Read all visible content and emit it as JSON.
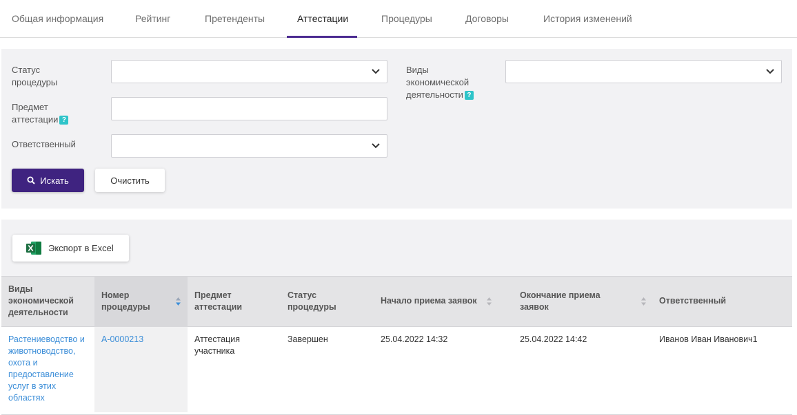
{
  "tabs": [
    {
      "label": "Общая информация"
    },
    {
      "label": "Рейтинг"
    },
    {
      "label": "Претенденты"
    },
    {
      "label": "Аттестации",
      "active": true
    },
    {
      "label": "Процедуры"
    },
    {
      "label": "Договоры"
    },
    {
      "label": "История изменений"
    }
  ],
  "filters": {
    "status_label": "Статус процедуры",
    "status_value": "",
    "subject_label": "Предмет аттестации",
    "subject_value": "",
    "responsible_label": "Ответственный",
    "responsible_value": "",
    "activity_label": "Виды экономической деятельности",
    "activity_value": "",
    "help_glyph": "?",
    "search_label": "Искать",
    "clear_label": "Очистить"
  },
  "results": {
    "export_label": "Экспорт в Excel",
    "columns": [
      "Виды экономической деятельности",
      "Номер процедуры",
      "Предмет аттестации",
      "Статус процедуры",
      "Начало приема заявок",
      "Окончание приема заявок",
      "Ответственный"
    ],
    "rows": [
      {
        "activity": "Растениеводство и животноводство, охота и предоставление услуг в этих областях",
        "number": "А-0000213",
        "subject": "Аттестация участника",
        "status": "Завершен",
        "start": "25.04.2022 14:32",
        "end": "25.04.2022 14:42",
        "responsible": "Иванов Иван Иванович1"
      }
    ]
  },
  "colors": {
    "accent": "#3f2380",
    "tab_underline": "#4b2b91",
    "link": "#3c8ed8",
    "help_badge": "#2ec4c9",
    "excel_green": "#1d6f42"
  },
  "icons": {
    "search": "search-icon",
    "select": "chevron-down-icon",
    "help": "help-icon",
    "excel": "excel-icon",
    "sort": "sort-icon"
  }
}
